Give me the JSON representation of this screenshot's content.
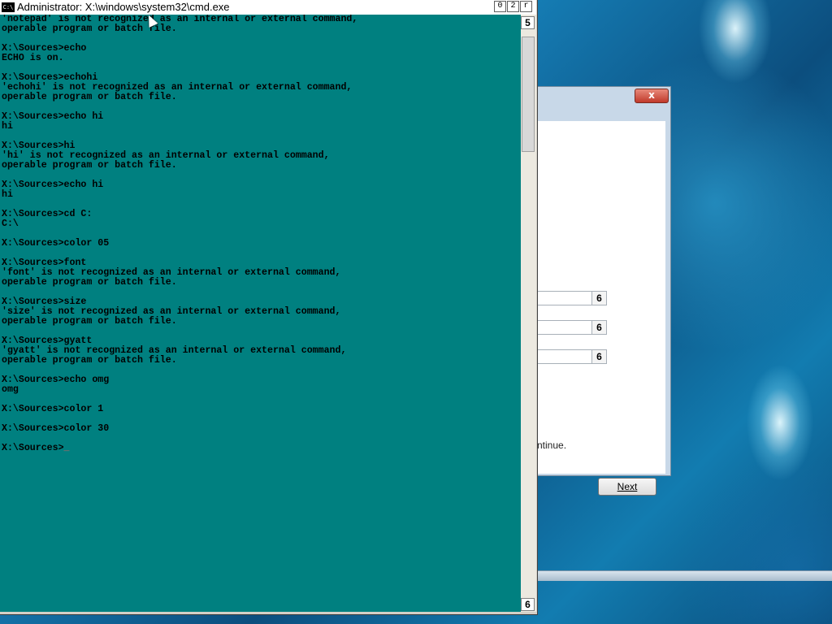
{
  "cmd": {
    "title": "Administrator: X:\\windows\\system32\\cmd.exe",
    "icon_label": "C:\\",
    "buttons": [
      "0",
      "2",
      "r"
    ],
    "scroll_up": "5",
    "scroll_down": "6",
    "console_text": "'notepad' is not recognized as an internal or external command,\noperable program or batch file.\n\nX:\\Sources>echo\nECHO is on.\n\nX:\\Sources>echohi\n'echohi' is not recognized as an internal or external command,\noperable program or batch file.\n\nX:\\Sources>echo hi\nhi\n\nX:\\Sources>hi\n'hi' is not recognized as an internal or external command,\noperable program or batch file.\n\nX:\\Sources>echo hi\nhi\n\nX:\\Sources>cd C:\nC:\\\n\nX:\\Sources>color 05\n\nX:\\Sources>font\n'font' is not recognized as an internal or external command,\noperable program or batch file.\n\nX:\\Sources>size\n'size' is not recognized as an internal or external command,\noperable program or batch file.\n\nX:\\Sources>gyatt\n'gyatt' is not recognized as an internal or external command,\noperable program or batch file.\n\nX:\\Sources>echo omg\nomg\n\nX:\\Sources>color 1\n\nX:\\Sources>color 30\n\nX:\\Sources>",
    "cursor": "_"
  },
  "setup": {
    "close_label": "x",
    "spinners": [
      "6",
      "6",
      "6"
    ],
    "continue_text": "ntinue.",
    "next_label": "Next"
  },
  "colors": {
    "console_bg": "#008080",
    "console_fg": "#000000"
  }
}
